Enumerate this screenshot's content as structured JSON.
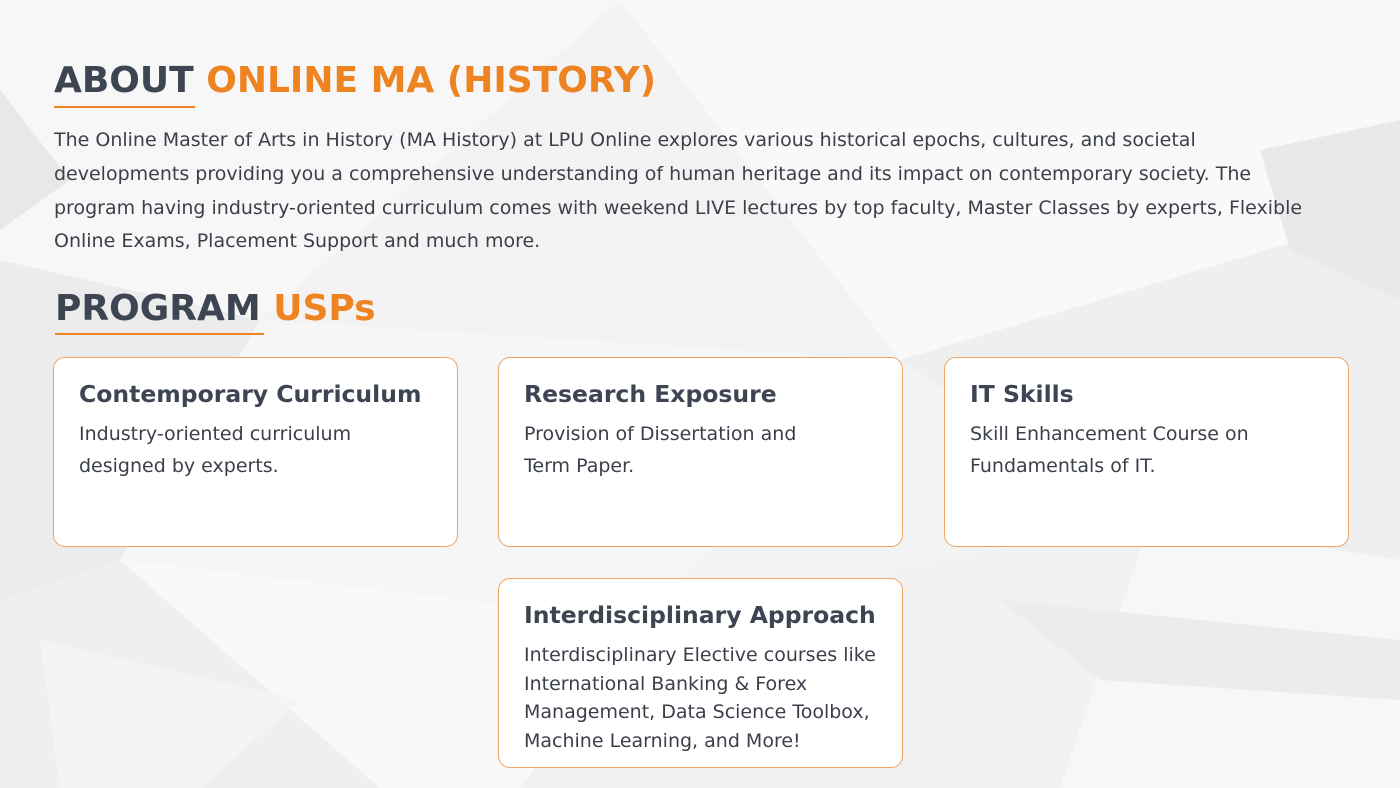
{
  "about": {
    "heading_dark": "ABOUT",
    "heading_orange": "ONLINE MA (HISTORY)",
    "paragraph": "The Online Master of Arts in History (MA History) at LPU Online explores various historical epochs, cultures, and societal developments providing you a comprehensive understanding of human heritage and its impact on contemporary society. The program having industry-oriented curriculum comes with weekend LIVE lectures by top faculty, Master Classes by experts, Flexible Online Exams, Placement Support and much more."
  },
  "usps": {
    "heading_dark": "PROGRAM",
    "heading_orange": "USPs",
    "cards": [
      {
        "title": "Contemporary Curriculum",
        "description": "Industry-oriented curriculum designed by experts."
      },
      {
        "title": "Research Exposure",
        "description": "Provision of Dissertation and Term Paper."
      },
      {
        "title": "IT Skills",
        "description": "Skill Enhancement Course on Fundamentals of IT."
      },
      {
        "title": "Interdisciplinary Approach",
        "description": "Interdisciplinary Elective courses like International Banking & Forex Management, Data Science Toolbox, Machine Learning, and More!"
      }
    ]
  },
  "colors": {
    "accent": "#ee8322",
    "heading_dark": "#3d4452",
    "body_text": "#3a3f4a",
    "card_border": "#f2a562",
    "background": "#f2f2f2"
  }
}
